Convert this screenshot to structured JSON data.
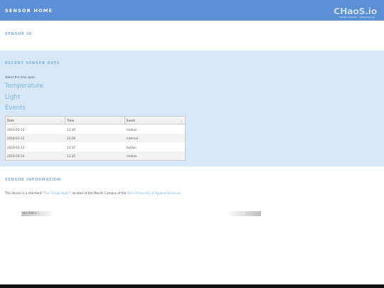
{
  "header": {
    "title": "SENSOR HOME",
    "logo_text": "CHaoS.io",
    "logo_tagline": "The Bern University · Applied Sciences"
  },
  "sections": {
    "sensor_id": "SENSOR ID",
    "recent": "RECENT SENSOR DATA",
    "info": "SENSOR INFORMATION"
  },
  "recent": {
    "hint": "Select the time span:",
    "links": [
      "Temperature",
      "Light",
      "Events"
    ],
    "table": {
      "columns": [
        "Date",
        "Time",
        "Event"
      ],
      "rows": [
        [
          "2016-03-13",
          "13:35",
          "motion"
        ],
        [
          "2016-03-13",
          "13:36",
          "interval"
        ],
        [
          "2016-03-13",
          "13:37",
          "button"
        ],
        [
          "2016-03-14",
          "13:35",
          "motion"
        ]
      ]
    }
  },
  "info": {
    "prefix": "The device is a standard \"",
    "device_link": "The Things Node",
    "middle": "\", located at the Marzili Campus of the ",
    "university_link": "Bern University of Applied Sciences",
    "suffix": "."
  },
  "carousel": {
    "image_alt": "Hak Bild an",
    "prev": "‹",
    "next": "›"
  },
  "colors": {
    "header_bg": "#5b8fd6",
    "band_bg": "#d8e8f8",
    "accent": "#7fb0d8"
  }
}
